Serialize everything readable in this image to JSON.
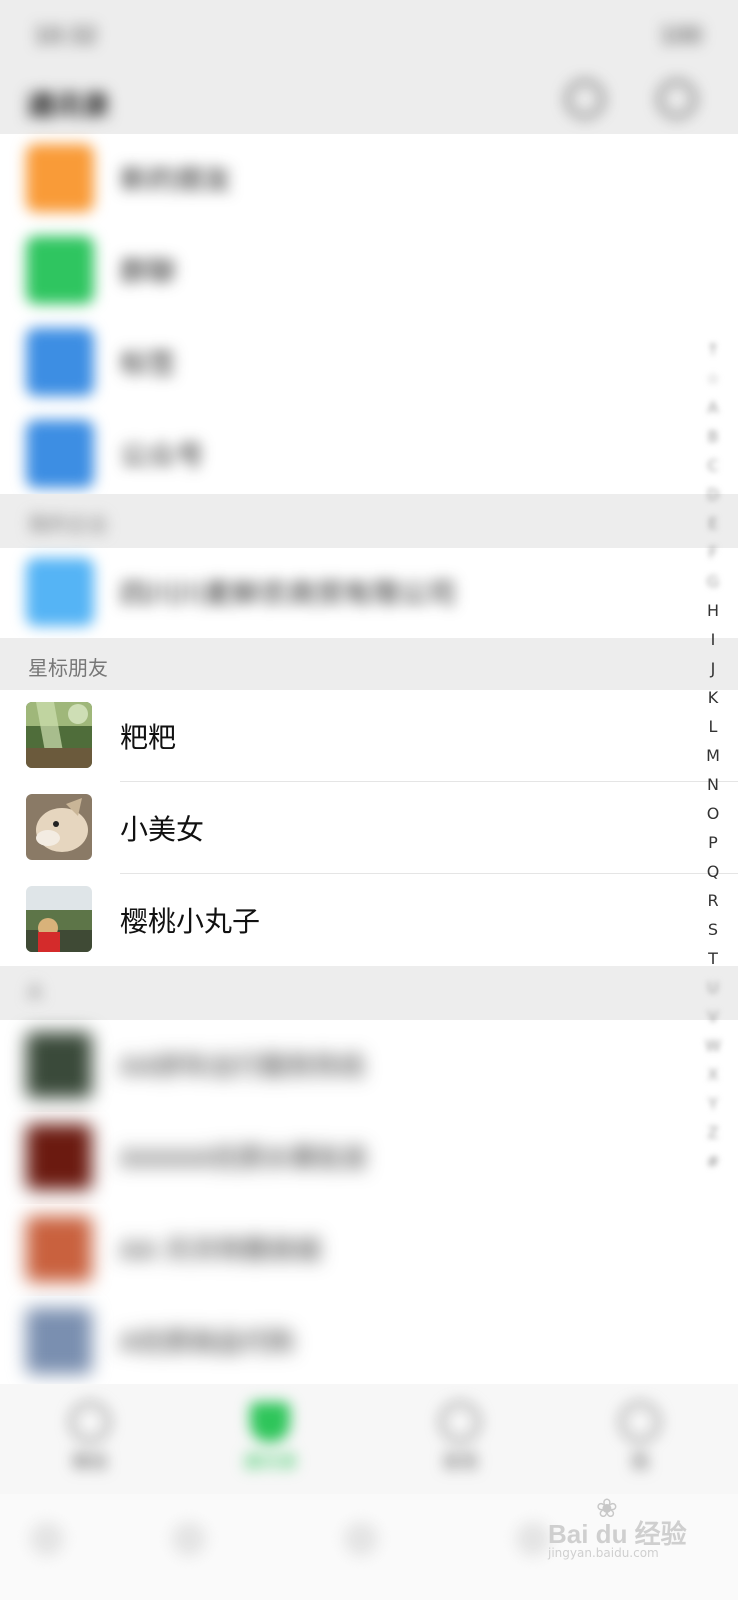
{
  "status": {
    "time": "10:32",
    "battery": "100"
  },
  "header": {
    "title": "通讯录"
  },
  "features": [
    {
      "label": "新的朋友",
      "color": "#f99b38",
      "icon": "person-add-icon"
    },
    {
      "label": "群聊",
      "color": "#2fc560",
      "icon": "group-icon"
    },
    {
      "label": "标签",
      "color": "#3d8ee3",
      "icon": "tag-icon"
    },
    {
      "label": "公众号",
      "color": "#3d8ee3",
      "icon": "official-account-icon"
    }
  ],
  "sections": {
    "my_company": "我的企业",
    "starred": "星标朋友",
    "letter_a": "A"
  },
  "company": {
    "name": "四川川麦鲜农商贸有限公司"
  },
  "starred_contacts": [
    {
      "name": "粑粑"
    },
    {
      "name": "小美女"
    },
    {
      "name": "樱桃小丸子"
    }
  ],
  "a_contacts": [
    {
      "name": "AA拼车出行服务热线"
    },
    {
      "name": "AAAAA优质水果批发"
    },
    {
      "name": "AA 天天特惠商城"
    },
    {
      "name": "A优质商品代购"
    }
  ],
  "index_letters": [
    "↑",
    "☆",
    "A",
    "B",
    "C",
    "D",
    "E",
    "F",
    "G",
    "H",
    "I",
    "J",
    "K",
    "L",
    "M",
    "N",
    "O",
    "P",
    "Q",
    "R",
    "S",
    "T",
    "U",
    "V",
    "W",
    "X",
    "Y",
    "Z",
    "#"
  ],
  "tabs": [
    {
      "label": "微信",
      "active": false
    },
    {
      "label": "通讯录",
      "active": true
    },
    {
      "label": "发现",
      "active": false
    },
    {
      "label": "我",
      "active": false
    }
  ],
  "watermark": {
    "brand": "Bai du 经验",
    "site": "jingyan.baidu.com"
  },
  "colors": {
    "accent": "#2ec55a",
    "section_bg": "#ededed"
  }
}
